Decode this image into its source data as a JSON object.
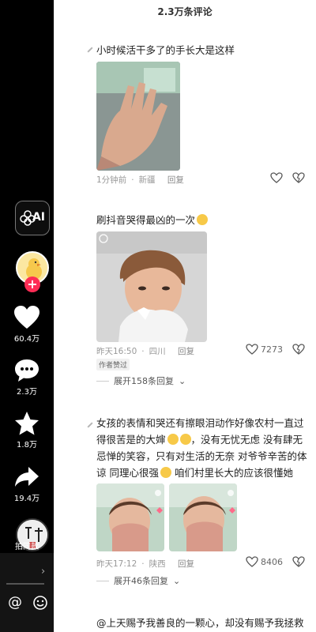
{
  "rail": {
    "ai_label": "AI",
    "like_count": "60.4万",
    "comment_count": "2.3万",
    "favorite_count": "1.8万",
    "share_count": "19.4万",
    "disc_text": "拍同款"
  },
  "panel": {
    "title": "2.3万条评论"
  },
  "comments": [
    {
      "text": "小时候活干多了的手长大是这样",
      "time": "1分钟前",
      "location": "新疆",
      "reply_label": "回复"
    },
    {
      "text": "刷抖音哭得最凶的一次",
      "time": "昨天16:50",
      "location": "四川",
      "reply_label": "回复",
      "likes": "7273",
      "badge": "作者赞过",
      "expand": "展开158条回复"
    },
    {
      "text_lines": [
        "女孩的表情和哭还有擦眼泪动作好像农村一直过",
        "得很苦是的大婶",
        "，没有无忧无虑 没有肆无",
        "忌惮的笑容，只有对生活的无奈 对爷爷辛苦的体",
        "谅 同理心很强",
        " 咱们村里长大的应该很懂她"
      ],
      "time": "昨天17:12",
      "location": "陕西",
      "reply_label": "回复",
      "likes": "8406",
      "expand": "展开46条回复"
    },
    {
      "text": "@上天赐予我善良的一颗心，却没有赐予我拯救"
    }
  ],
  "colors": {
    "accent": "#fe2c55",
    "rail_bg": "#000000"
  }
}
